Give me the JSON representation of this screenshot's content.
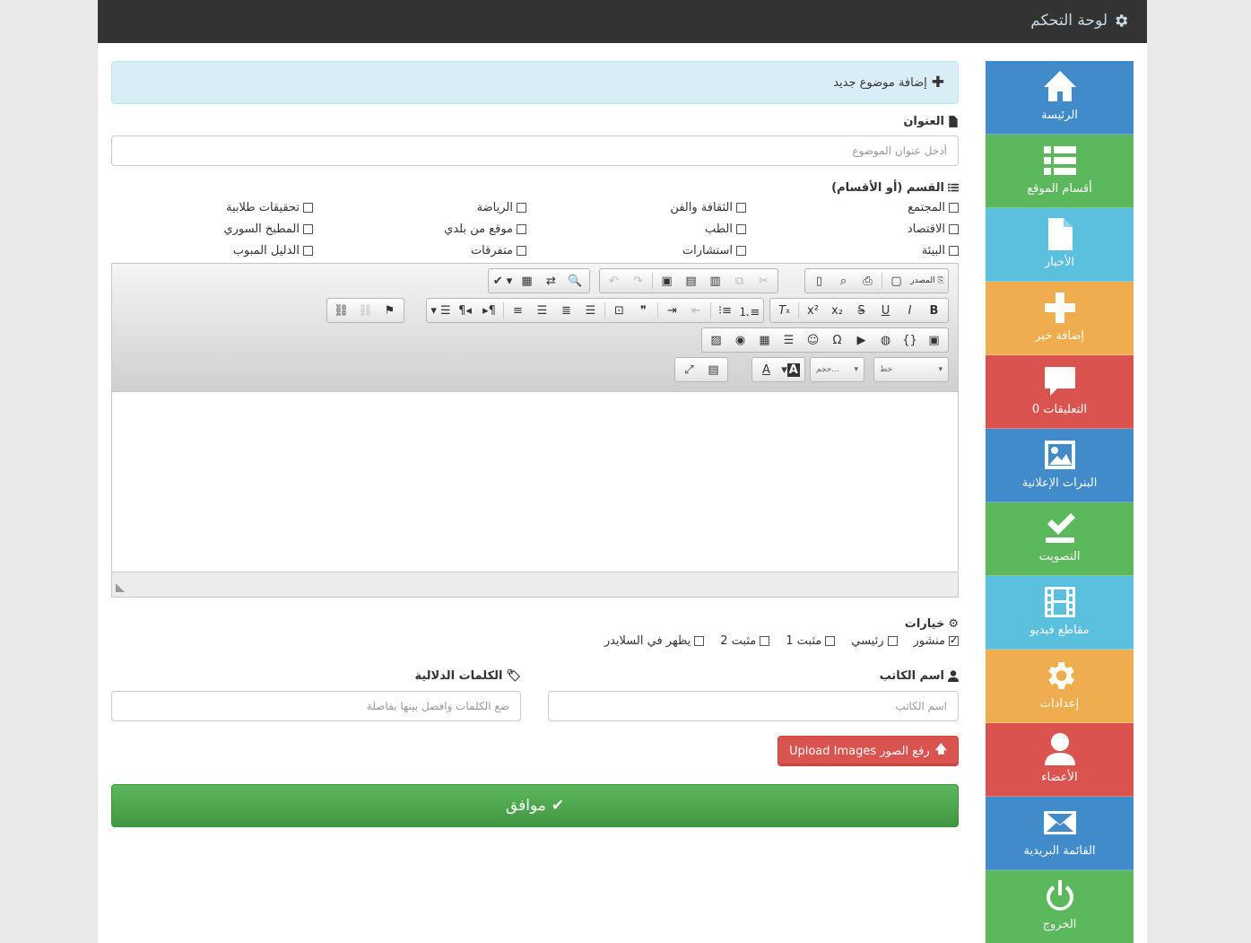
{
  "topbar": {
    "title": "لوحة التحكم"
  },
  "sidebar": [
    {
      "label": "الرئيسة",
      "icon": "home-icon",
      "color": "#428bca"
    },
    {
      "label": "أقسام الموقع",
      "icon": "list-icon",
      "color": "#5cb85c"
    },
    {
      "label": "الأخبار",
      "icon": "file-icon",
      "color": "#5bc0de"
    },
    {
      "label": "إضافة خبر",
      "icon": "plus-icon",
      "color": "#f0ad4e"
    },
    {
      "label": "التعليقات 0",
      "icon": "comment-icon",
      "color": "#d9534f"
    },
    {
      "label": "البنرات الإعلانية",
      "icon": "image-icon",
      "color": "#428bca"
    },
    {
      "label": "التصويت",
      "icon": "vote-icon",
      "color": "#5cb85c"
    },
    {
      "label": "مقاطع فيديو",
      "icon": "film-icon",
      "color": "#5bc0de"
    },
    {
      "label": "إعدادات",
      "icon": "cog-icon",
      "color": "#f0ad4e"
    },
    {
      "label": "الأعضاء",
      "icon": "user-icon",
      "color": "#d9534f"
    },
    {
      "label": "القائمة البريدية",
      "icon": "envelope-icon",
      "color": "#428bca"
    },
    {
      "label": "الخروج",
      "icon": "power-icon",
      "color": "#5cb85c"
    }
  ],
  "alert": {
    "text": "إضافة موضوع جديد"
  },
  "title_field": {
    "label": "العنوان",
    "placeholder": "أدخل عنوان الموضوع"
  },
  "categories": {
    "label": "القسم (أو الأقسام)",
    "items": [
      "المجتمع",
      "الثقافة والفن",
      "الرياضة",
      "تحقيقات طلابية",
      "الاقتصاد",
      "الطب",
      "موقع من بلدي",
      "المطبخ السوري",
      "البيئة",
      "استشارات",
      "متفرقات",
      "الدليل المبوب"
    ]
  },
  "editor": {
    "source_label": "المصدر",
    "font_combo": "خط",
    "size_combo": "حجم..."
  },
  "options": {
    "label": "خيارات",
    "items": [
      {
        "label": "منشور",
        "checked": true
      },
      {
        "label": "رئيسي",
        "checked": false
      },
      {
        "label": "مثبت 1",
        "checked": false
      },
      {
        "label": "مثبت 2",
        "checked": false
      },
      {
        "label": "يظهر في السلايدر",
        "checked": false
      }
    ]
  },
  "author": {
    "label": "اسم الكاتب",
    "placeholder": "اسم الكاتب"
  },
  "tags": {
    "label": "الكلمات الدلالية",
    "placeholder": "ضع الكلمات وافصل بينها بفاصلة"
  },
  "upload_button": {
    "label": "رفع الصور Upload Images"
  },
  "submit_button": {
    "label": "موافق"
  }
}
